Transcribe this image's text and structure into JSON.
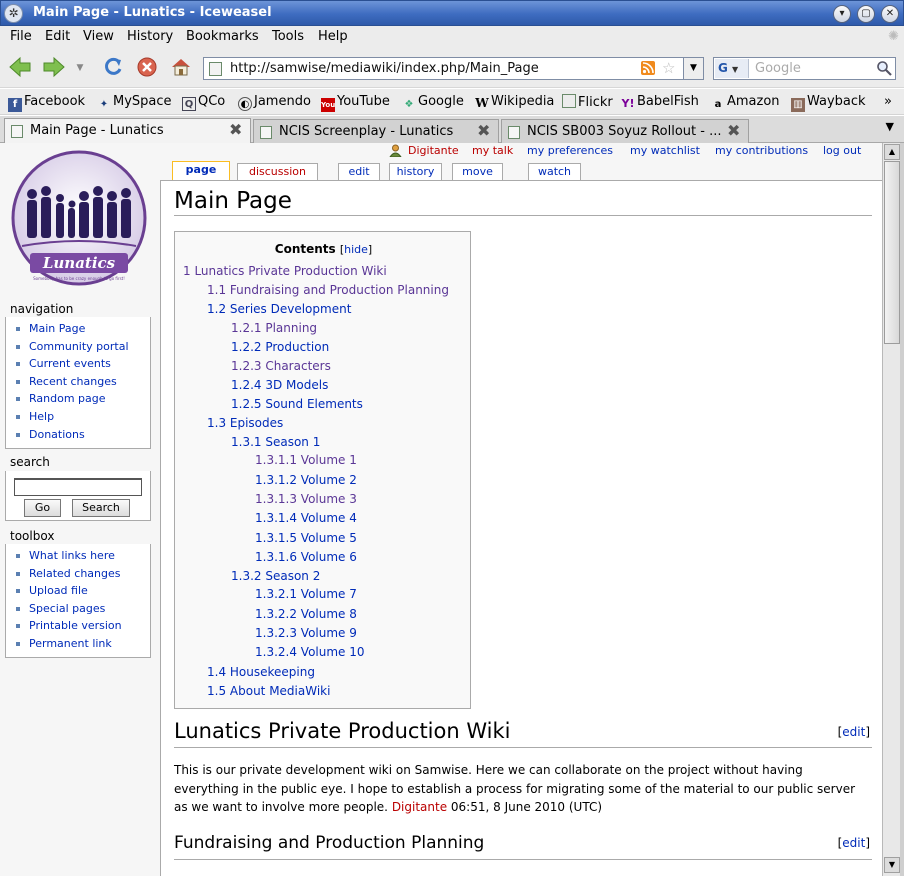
{
  "window": {
    "title": "Main Page - Lunatics - Iceweasel"
  },
  "menu": [
    "File",
    "Edit",
    "View",
    "History",
    "Bookmarks",
    "Tools",
    "Help"
  ],
  "navbar": {
    "url": "http://samwise/mediawiki/index.php/Main_Page",
    "search_placeholder": "Google",
    "search_engine": "G"
  },
  "bookmarks": [
    "Facebook",
    "MySpace",
    "QCo",
    "Jamendo",
    "YouTube",
    "Google",
    "Wikipedia",
    "Flickr",
    "BabelFish",
    "Amazon",
    "Wayback"
  ],
  "bookmarks_more": "»",
  "tabs": [
    {
      "label": "Main Page - Lunatics"
    },
    {
      "label": "NCIS Screenplay - Lunatics"
    },
    {
      "label": "NCIS SB003 Soyuz Rollout - ..."
    }
  ],
  "personal": {
    "user": "Digitante",
    "talk": "my talk",
    "prefs": "my preferences",
    "watchlist": "my watchlist",
    "contribs": "my contributions",
    "logout": "log out"
  },
  "ctabs": {
    "page": "page",
    "discussion": "discussion",
    "edit": "edit",
    "history": "history",
    "move": "move",
    "watch": "watch"
  },
  "logo": {
    "text": "Lunatics",
    "tagline": "Somebody has to be crazy enough to go first!"
  },
  "sidebar": {
    "navigation_title": "navigation",
    "navigation": [
      "Main Page",
      "Community portal",
      "Current events",
      "Recent changes",
      "Random page",
      "Help",
      "Donations"
    ],
    "search_title": "search",
    "go": "Go",
    "search": "Search",
    "toolbox_title": "toolbox",
    "toolbox": [
      "What links here",
      "Related changes",
      "Upload file",
      "Special pages",
      "Printable version",
      "Permanent link"
    ]
  },
  "article": {
    "title": "Main Page",
    "toc_title": "Contents",
    "toc_hide": "hide",
    "toc": [
      "1 Lunatics Private Production Wiki",
      "1.1 Fundraising and Production Planning",
      "1.2 Series Development",
      "1.2.1 Planning",
      "1.2.2 Production",
      "1.2.3 Characters",
      "1.2.4 3D Models",
      "1.2.5 Sound Elements",
      "1.3 Episodes",
      "1.3.1 Season 1",
      "1.3.1.1 Volume 1",
      "1.3.1.2 Volume 2",
      "1.3.1.3 Volume 3",
      "1.3.1.4 Volume 4",
      "1.3.1.5 Volume 5",
      "1.3.1.6 Volume 6",
      "1.3.2 Season 2",
      "1.3.2.1 Volume 7",
      "1.3.2.2 Volume 8",
      "1.3.2.3 Volume 9",
      "1.3.2.4 Volume 10",
      "1.4 Housekeeping",
      "1.5 About MediaWiki"
    ],
    "section1_title": "Lunatics Private Production Wiki",
    "edit": "edit",
    "para_text": "This is our private development wiki on Samwise. Here we can collaborate on the project without having everything in the public eye. I hope to establish a process for migrating some of the material to our public server as we want to involve more people. ",
    "para_sig": "Digitante",
    "para_time": " 06:51, 8 June 2010 (UTC)",
    "section2_title": "Fundraising and Production Planning"
  },
  "colors": {
    "link": "#002bb8",
    "visited": "#5a3696",
    "new": "#ba0000",
    "titlebar": "#3e6cc0"
  }
}
